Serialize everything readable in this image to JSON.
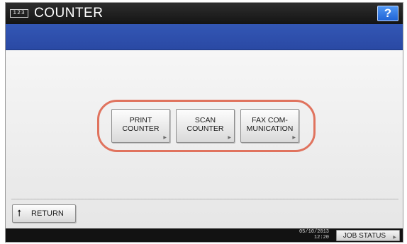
{
  "header": {
    "counter_icon_text": "123",
    "title": "COUNTER",
    "help_label": "?"
  },
  "menu": {
    "buttons": [
      {
        "label": "PRINT\nCOUNTER"
      },
      {
        "label": "SCAN\nCOUNTER"
      },
      {
        "label": "FAX COM-\nMUNICATION"
      }
    ],
    "arrow_icon": "triangle-right-icon"
  },
  "footer": {
    "return_label": "RETURN",
    "return_icon": "return-arrow-icon"
  },
  "statusbar": {
    "date": "05/10/2013",
    "time": "12:20",
    "job_status_label": "JOB STATUS"
  },
  "colors": {
    "title_bar": "#1a1a1a",
    "blue_bar": "#2f52ae",
    "help_button": "#2f7ae8",
    "highlight_ring": "#e0735e"
  }
}
